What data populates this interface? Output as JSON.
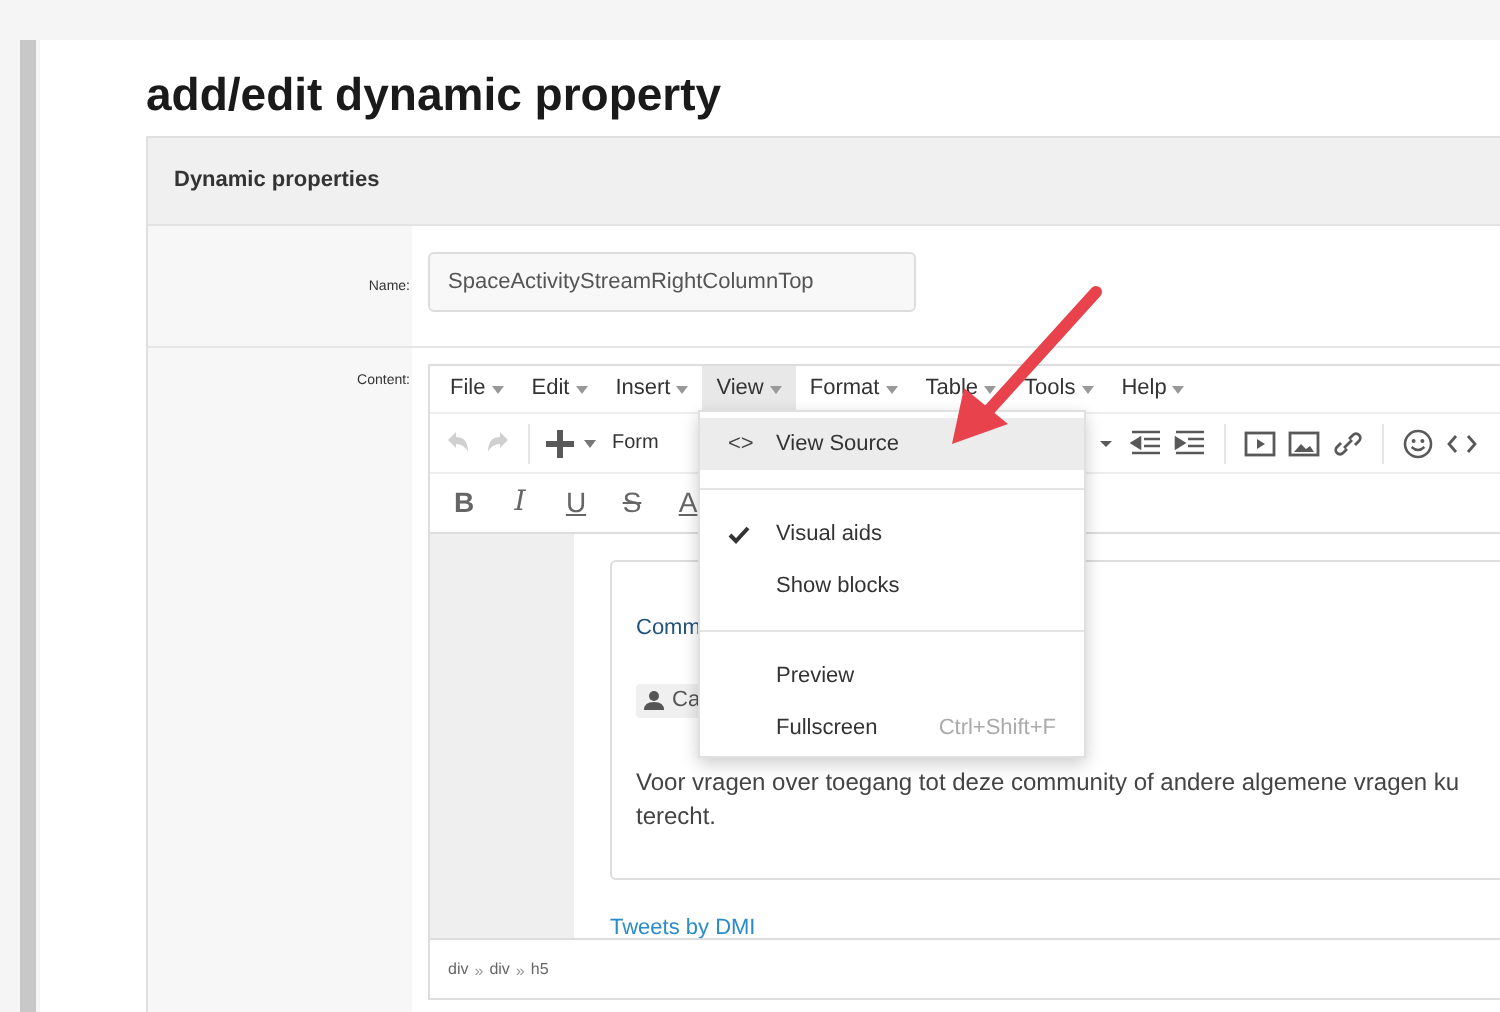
{
  "page_title": "add/edit dynamic property",
  "card": {
    "header": "Dynamic properties",
    "name_field": {
      "label": "Name:",
      "value": "SpaceActivityStreamRightColumnTop"
    },
    "content_label": "Content:"
  },
  "editor": {
    "menubar": [
      {
        "label": "File",
        "selected": false
      },
      {
        "label": "Edit",
        "selected": false
      },
      {
        "label": "Insert",
        "selected": false
      },
      {
        "label": "View",
        "selected": true
      },
      {
        "label": "Format",
        "selected": false
      },
      {
        "label": "Table",
        "selected": false
      },
      {
        "label": "Tools",
        "selected": false
      },
      {
        "label": "Help",
        "selected": false
      }
    ],
    "toolbar_left": [
      {
        "kind": "undo",
        "disabled": true
      },
      {
        "kind": "redo",
        "disabled": true
      },
      {
        "kind": "sep"
      },
      {
        "kind": "plus",
        "disabled": false
      }
    ],
    "formats_label": "Form",
    "toolbar_right": [
      {
        "kind": "caret"
      },
      {
        "kind": "outdent"
      },
      {
        "kind": "indent"
      },
      {
        "kind": "sep"
      },
      {
        "kind": "media"
      },
      {
        "kind": "image"
      },
      {
        "kind": "link"
      },
      {
        "kind": "sep"
      },
      {
        "kind": "emoji"
      },
      {
        "kind": "code"
      }
    ],
    "format_buttons": [
      {
        "label": "B",
        "kind": "bold"
      },
      {
        "label": "I",
        "kind": "italic"
      },
      {
        "label": "U",
        "kind": "underline"
      },
      {
        "label": "S",
        "kind": "strike"
      },
      {
        "label": "A",
        "kind": "color"
      }
    ],
    "content": {
      "heading": "Comm",
      "tag": "Ca",
      "paragraph": "Voor vragen over toegang tot deze community of andere algemene vragen ku",
      "paragraph_2": "terecht.",
      "link": "Tweets by DMI"
    },
    "path": [
      "div",
      "div",
      "h5"
    ],
    "path_separator": "»"
  },
  "view_menu": [
    {
      "kind": "item",
      "label": "View Source",
      "icon": "<>",
      "highlighted": true,
      "checked": false
    },
    {
      "kind": "divider"
    },
    {
      "kind": "item",
      "label": "Visual aids",
      "highlighted": false,
      "checked": true
    },
    {
      "kind": "item",
      "label": "Show blocks",
      "highlighted": false,
      "checked": false
    },
    {
      "kind": "divider"
    },
    {
      "kind": "item",
      "label": "Preview",
      "highlighted": false,
      "checked": false
    },
    {
      "kind": "item",
      "label": "Fullscreen",
      "shortcut": "Ctrl+Shift+F",
      "highlighted": false,
      "checked": false
    }
  ]
}
